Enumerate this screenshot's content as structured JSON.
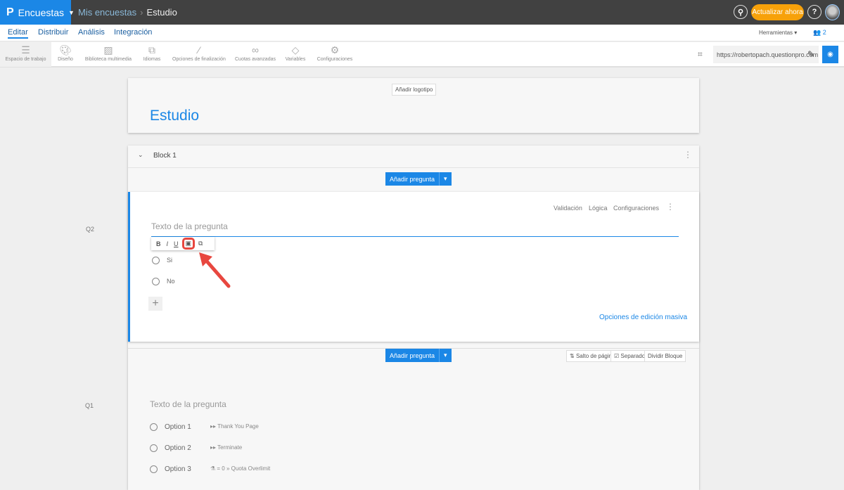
{
  "header": {
    "brand": "Encuestas",
    "breadcrumb": [
      "Mis encuestas",
      "Estudio"
    ],
    "upgrade": "Actualizar ahora",
    "help": "?"
  },
  "nav": {
    "tabs": [
      "Editar",
      "Distribuir",
      "Análisis",
      "Integración"
    ],
    "tools_label": "Herramientas",
    "collaborators": "2"
  },
  "toolbar": {
    "items": [
      "Espacio de trabajo",
      "Diseño",
      "Biblioteca multimedia",
      "Idiomas",
      "Opciones de finalización",
      "Cuotas avanzadas",
      "Variables",
      "Configuraciones"
    ],
    "url": "https://robertopach.questionpro.com"
  },
  "survey": {
    "add_logo": "Añadir logotipo",
    "title": "Estudio",
    "block": "Block 1",
    "add_question": "Añadir pregunta",
    "q2": {
      "number": "Q2",
      "placeholder": "Texto de la pregunta",
      "actions": [
        "Validación",
        "Lógica",
        "Configuraciones"
      ],
      "format": [
        "B",
        "I",
        "U"
      ],
      "options": [
        "Si",
        "No"
      ],
      "bulk": "Opciones de edición masiva"
    },
    "divider": {
      "page_break": "Salto de página",
      "separator": "Separador",
      "split": "Dividir Bloque"
    },
    "q1": {
      "number": "Q1",
      "placeholder": "Texto de la pregunta",
      "options": [
        {
          "label": "Option 1",
          "logic": "Thank You Page"
        },
        {
          "label": "Option 2",
          "logic": "Terminate"
        },
        {
          "label": "Option 3",
          "logic": "= 0 » Quota Overlimit"
        }
      ]
    }
  }
}
